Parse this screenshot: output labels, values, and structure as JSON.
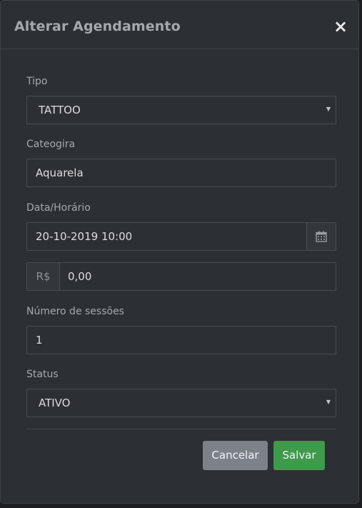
{
  "dialog": {
    "title": "Alterar Agendamento"
  },
  "form": {
    "tipo": {
      "label": "Tipo",
      "value": "TATTOO"
    },
    "categoria": {
      "label": "Cateogira",
      "value": "Aquarela"
    },
    "data_horario": {
      "label": "Data/Horário",
      "value": "20-10-2019 10:00"
    },
    "valor": {
      "prefix": "R$",
      "value": "0,00"
    },
    "sessoes": {
      "label": "Número de sessões",
      "value": "1"
    },
    "status": {
      "label": "Status",
      "value": "ATIVO"
    }
  },
  "footer": {
    "cancel_label": "Cancelar",
    "save_label": "Salvar"
  },
  "icons": {
    "close": "close-icon",
    "calendar": "calendar-icon",
    "select_caret": "caret-down-icon"
  },
  "colors": {
    "modal_bg": "#2c2f34",
    "cancel_button": "#7d8289",
    "save_button": "#3f9a4b"
  }
}
